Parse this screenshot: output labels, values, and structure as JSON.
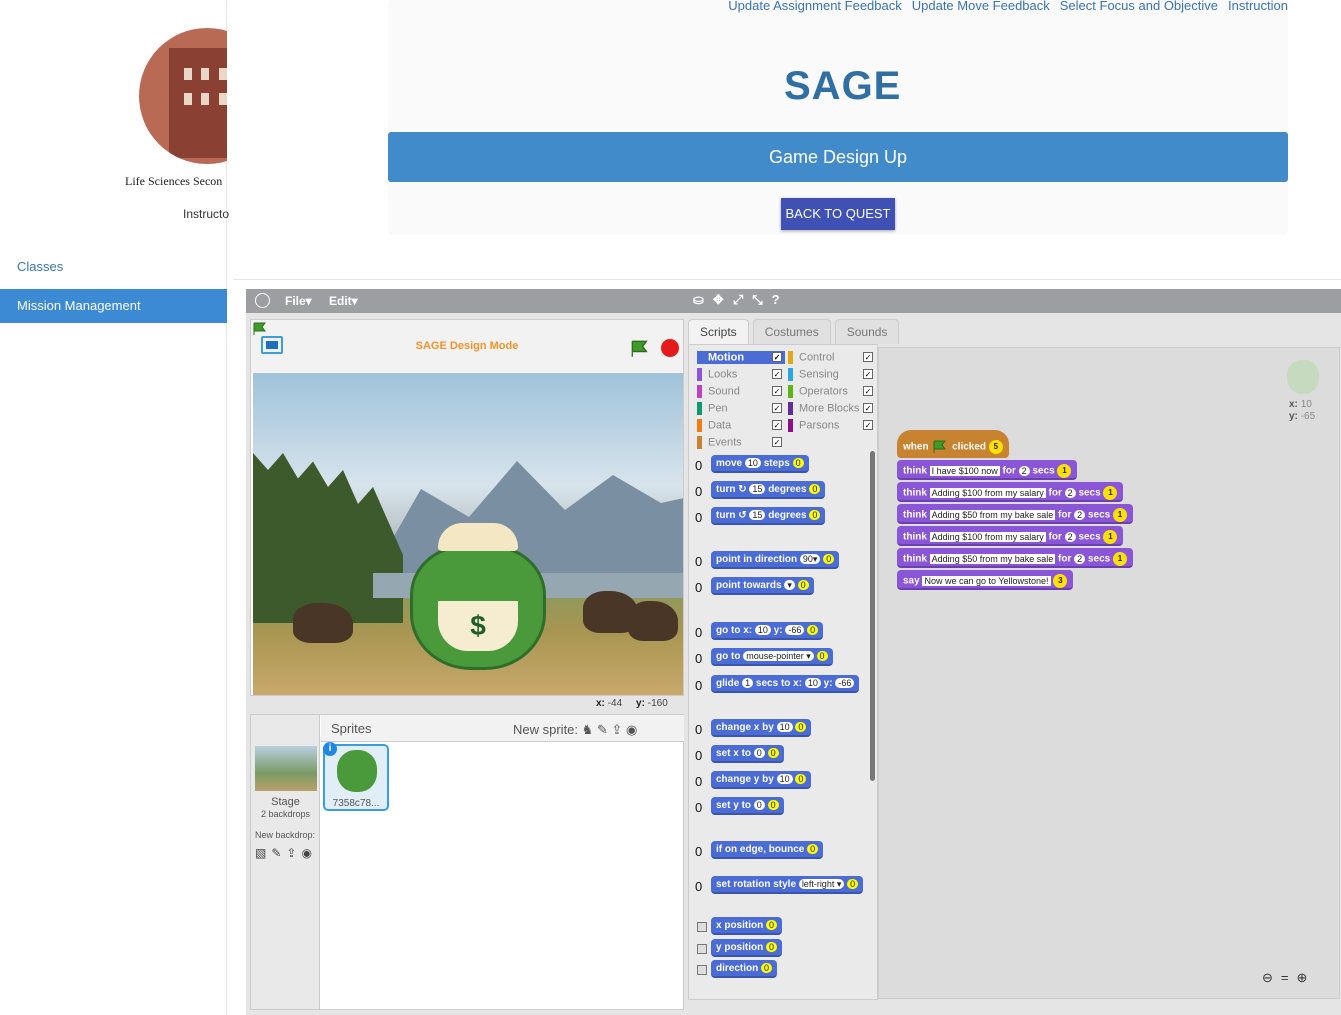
{
  "sidebar": {
    "school_name": "Life Sciences Secon",
    "instructor": "Instructo",
    "nav": [
      {
        "label": "Classes"
      },
      {
        "label": "Mission Management"
      }
    ]
  },
  "header": {
    "links": [
      "Update Assignment Feedback",
      "Update Move Feedback",
      "Select Focus and Objective",
      "Instruction"
    ],
    "logo": "SAGE",
    "banner": "Game Design Up",
    "back_button": "BACK TO QUEST"
  },
  "menubar": {
    "file": "File▾",
    "edit": "Edit▾",
    "tools": [
      "⛀",
      "✥",
      "⤢",
      "⤡",
      "?"
    ]
  },
  "stage": {
    "title": "SAGE Design Mode",
    "jar_symbol": "$",
    "coords": {
      "x_label": "x:",
      "x": "-44",
      "y_label": "y:",
      "y": "-160"
    }
  },
  "sprites": {
    "title": "Sprites",
    "new_sprite": "New sprite:",
    "stage_label": "Stage",
    "stage_sub": "2 backdrops",
    "new_backdrop": "New backdrop:",
    "sprite_name": "7358c78..."
  },
  "tabs": [
    "Scripts",
    "Costumes",
    "Sounds"
  ],
  "categories": [
    {
      "name": "Motion",
      "color": "#4a6cd4"
    },
    {
      "name": "Looks",
      "color": "#8a55d7"
    },
    {
      "name": "Sound",
      "color": "#bb42c3"
    },
    {
      "name": "Pen",
      "color": "#0e9a6c"
    },
    {
      "name": "Data",
      "color": "#ee7d16"
    },
    {
      "name": "Events",
      "color": "#c88330"
    },
    {
      "name": "Control",
      "color": "#e1a91a"
    },
    {
      "name": "Sensing",
      "color": "#2ca5e2"
    },
    {
      "name": "Operators",
      "color": "#5cb712"
    },
    {
      "name": "More Blocks",
      "color": "#632d99"
    },
    {
      "name": "Parsons",
      "color": "#8b0f8b"
    }
  ],
  "palette_blocks": [
    {
      "a": "move",
      "n1": "10",
      "b": "steps",
      "y": "0"
    },
    {
      "a": "turn ↻",
      "n1": "15",
      "b": "degrees",
      "y": "0"
    },
    {
      "a": "turn ↺",
      "n1": "15",
      "b": "degrees",
      "y": "0"
    },
    {
      "a": "point in direction",
      "n1": "90▾",
      "b": "",
      "y": "0"
    },
    {
      "a": "point towards",
      "n1": " ▾",
      "b": "",
      "y": "0"
    },
    {
      "a": "go to x:",
      "n1": "10",
      "b": "y:",
      "n2": "-66",
      "y": "0"
    },
    {
      "a": "go to",
      "n1": "mouse-pointer ▾",
      "b": "",
      "y": "0"
    },
    {
      "a": "glide",
      "n1": "1",
      "b": "secs to x:",
      "n2": "10",
      "c": "y:",
      "n3": "-66"
    },
    {
      "a": "change x by",
      "n1": "10",
      "b": "",
      "y": "0"
    },
    {
      "a": "set x to",
      "n1": "0",
      "b": "",
      "y": "0"
    },
    {
      "a": "change y by",
      "n1": "10",
      "b": "",
      "y": "0"
    },
    {
      "a": "set y to",
      "n1": "0",
      "b": "",
      "y": "0"
    },
    {
      "a": "if on edge, bounce",
      "n1": "",
      "b": "",
      "y": "0"
    },
    {
      "a": "set rotation style",
      "n1": "left-right ▾",
      "b": "",
      "y": "0"
    },
    {
      "a": "x position",
      "n1": "",
      "b": "",
      "y": "0"
    },
    {
      "a": "y position",
      "n1": "",
      "b": "",
      "y": "0"
    },
    {
      "a": "direction",
      "n1": "",
      "b": "",
      "y": "0"
    }
  ],
  "script": {
    "hat": {
      "when": "when",
      "clicked": "clicked",
      "badge": "5"
    },
    "blocks": [
      {
        "verb": "think",
        "text": "I have $100 now",
        "for": "for",
        "secs_val": "2",
        "secs": "secs",
        "badge": "1"
      },
      {
        "verb": "think",
        "text": "Adding $100 from my salary",
        "for": "for",
        "secs_val": "2",
        "secs": "secs",
        "badge": "1"
      },
      {
        "verb": "think",
        "text": "Adding $50 from my bake sale",
        "for": "for",
        "secs_val": "2",
        "secs": "secs",
        "badge": "1"
      },
      {
        "verb": "think",
        "text": "Adding $100 from my salary",
        "for": "for",
        "secs_val": "2",
        "secs": "secs",
        "badge": "1"
      },
      {
        "verb": "think",
        "text": "Adding $50 from my bake sale",
        "for": "for",
        "secs_val": "2",
        "secs": "secs",
        "badge": "1"
      },
      {
        "verb": "say",
        "text": "Now we can go to Yellowstone!",
        "badge": "3"
      }
    ]
  },
  "sprite_xy": {
    "x_label": "x:",
    "x": "10",
    "y_label": "y:",
    "y": "-65"
  }
}
